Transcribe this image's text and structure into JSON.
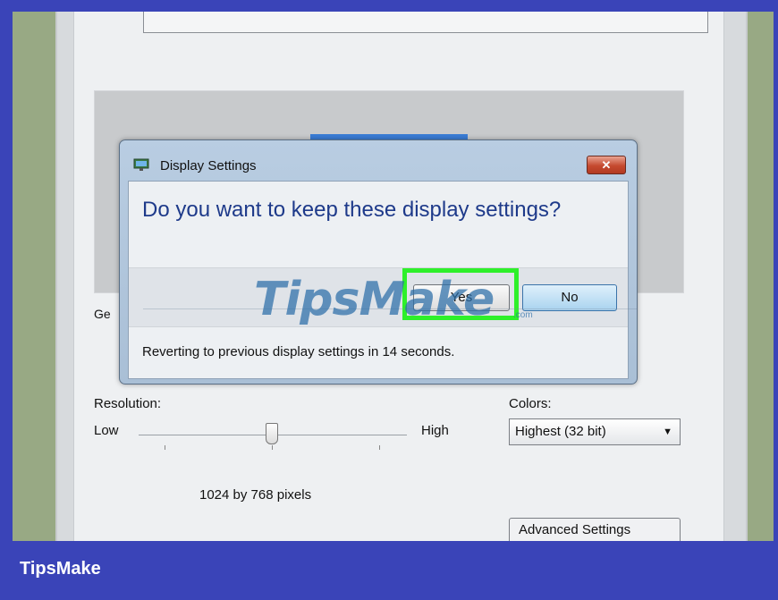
{
  "panel": {
    "general_label": "Ge",
    "resolution_label": "Resolution:",
    "low_label": "Low",
    "high_label": "High",
    "pixels_label": "1024 by 768 pixels",
    "colors_label": "Colors:",
    "colors_value": "Highest (32 bit)",
    "colors_arrow": "▼",
    "advanced_button": "Advanced Settings"
  },
  "dialog": {
    "title": "Display Settings",
    "close_glyph": "✕",
    "question": "Do you want to keep these display settings?",
    "yes_label": "Yes",
    "no_label": "No",
    "revert_text": "Reverting to previous display settings in 14 seconds."
  },
  "watermark": {
    "text": "TipsMake",
    "suffix": ".com"
  },
  "brand": {
    "label": "TipsMake"
  },
  "colors": {
    "highlight": "#2ef02a",
    "brand_bar": "#3a44b8",
    "question_text": "#1e3a8a"
  }
}
